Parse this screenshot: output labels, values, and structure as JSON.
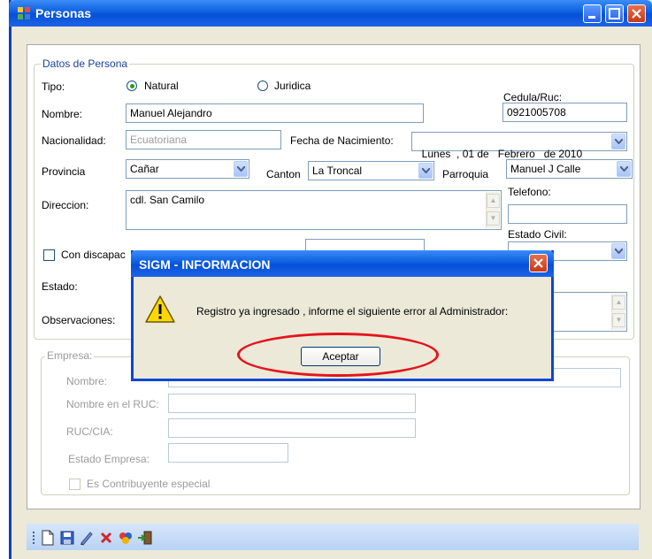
{
  "window": {
    "title": "Personas",
    "colors": {
      "titlebar": "#0d5fe0",
      "face": "#ece9d8"
    }
  },
  "persona": {
    "group_title": "Datos de Persona",
    "tipo_label": "Tipo:",
    "tipo_natural": "Natural",
    "tipo_juridica": "Juridica",
    "tipo_selected": "Natural",
    "cedula_label": "Cedula/Ruc:",
    "cedula_value": "0921005708",
    "nombre_label": "Nombre:",
    "nombre_value": "Manuel Alejandro",
    "nacionalidad_label": "Nacionalidad:",
    "nacionalidad_value": "Ecuatoriana",
    "fecha_label": "Fecha de Nacimiento:",
    "fecha_value": "Lunes  , 01 de   Febrero   de 2010",
    "provincia_label": "Provincia",
    "provincia_value": "Cañar",
    "canton_label": "Canton",
    "canton_value": "La Troncal",
    "parroquia_label": "Parroquia",
    "parroquia_value": "Manuel J Calle",
    "direccion_label": "Direccion:",
    "direccion_value": "cdl. San Camilo",
    "telefono_label": "Telefono:",
    "estado_civil_label": "Estado Civil:",
    "discapacidad_label": "Con discapac",
    "estado_label": "Estado:",
    "observaciones_label": "Observaciones:"
  },
  "empresa": {
    "group_title": "Empresa:",
    "nombre_label": "Nombre:",
    "nombre_ruc_label": "Nombre en el RUC:",
    "ruc_label": "RUC/CIA:",
    "estado_label": "Estado Empresa:",
    "contribuyente_label": "Es Contribuyente especial"
  },
  "toolbar": {
    "icons": [
      "new-icon",
      "save-icon",
      "edit-icon",
      "delete-icon",
      "refresh-icon",
      "exit-icon"
    ]
  },
  "dialog": {
    "title": "SIGM - INFORMACION",
    "message": "Registro ya ingresado , informe el siguiente error al Administrador:",
    "ok_label": "Aceptar",
    "icon": "warning-icon",
    "highlight_color": "#e3151c"
  }
}
